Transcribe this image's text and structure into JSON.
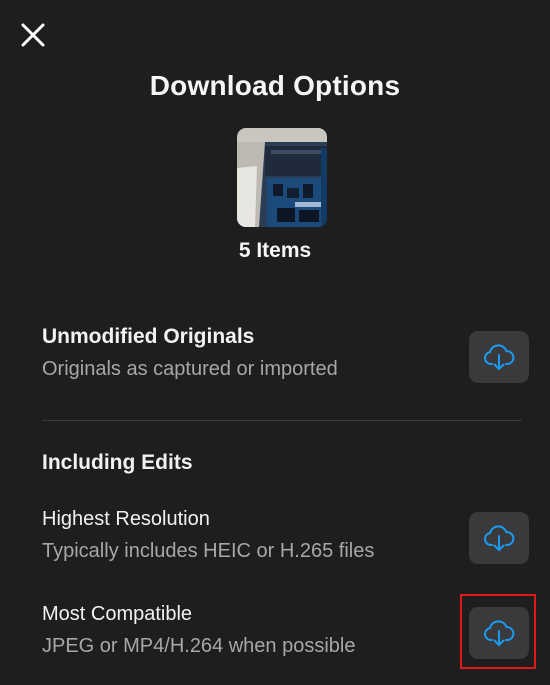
{
  "dialog": {
    "title": "Download Options",
    "item_count_label": "5 Items"
  },
  "unmodified": {
    "title": "Unmodified Originals",
    "subtitle": "Originals as captured or imported"
  },
  "including_edits": {
    "section_title": "Including Edits",
    "options": [
      {
        "title": "Highest Resolution",
        "subtitle": "Typically includes HEIC or H.265 files"
      },
      {
        "title": "Most Compatible",
        "subtitle": "JPEG or MP4/H.264 when possible"
      }
    ]
  },
  "icons": {
    "close": "close-icon",
    "download": "cloud-download-icon"
  },
  "colors": {
    "background": "#1e1e1f",
    "button_bg": "#3a3a3c",
    "accent": "#1a9bf0",
    "secondary_text": "#a7a7a9",
    "highlight": "#e0191b"
  }
}
